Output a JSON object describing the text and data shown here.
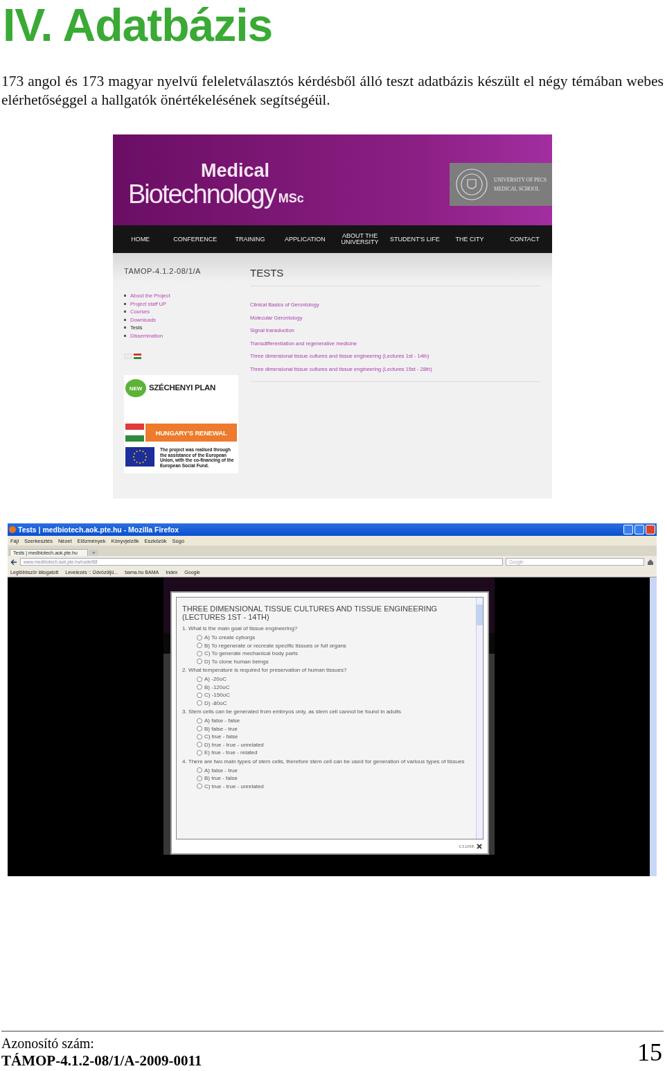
{
  "heading": "IV. Adatbázis",
  "intro": "173 angol és 173 magyar nyelvű feleletválasztós kérdésből álló teszt adatbázis készült el négy témában webes elérhetőséggel a hallgatók önértékelésének segítségéül.",
  "site_screenshot": {
    "logo": {
      "line1": "Medical",
      "line2": "Biotechnology",
      "suffix": "MSc"
    },
    "university_badge": [
      "UNIVERSITY OF PECS",
      "MEDICAL SCHOOL"
    ],
    "nav": [
      "HOME",
      "CONFERENCE",
      "TRAINING",
      "APPLICATION",
      "ABOUT THE UNIVERSITY",
      "STUDENT'S LIFE",
      "THE CITY",
      "CONTACT"
    ],
    "sidebar": {
      "project_code": "TAMOP-4.1.2-08/1/A",
      "links": [
        {
          "label": "About the Project",
          "selected": false
        },
        {
          "label": "Project staff UP",
          "selected": false
        },
        {
          "label": "Courses",
          "selected": false
        },
        {
          "label": "Downloads",
          "selected": false
        },
        {
          "label": "Tests",
          "selected": true
        },
        {
          "label": "Dissemination",
          "selected": false
        }
      ]
    },
    "logos": {
      "new_badge": "NEW",
      "plan": "SZÉCHENYI PLAN",
      "renewal": "HUNGARY'S RENEWAL",
      "eu_note": "The project was realised through the assistance of the European Union, with the co-financing of the European Social Fund."
    },
    "main": {
      "title": "TESTS",
      "links": [
        "Clinical Basics of Gerontology",
        "Molecular Gerontology",
        "Signal transduction",
        "Transdifferentiation and regenerative medicine",
        "Three dimensional tissue cultures and tissue engineering (Lectures 1st - 14th)",
        "Three dimensional tissue cultures and tissue engineering (Lectures 15st - 28th)"
      ]
    }
  },
  "browser": {
    "title": "Tests | medbiotech.aok.pte.hu - Mozilla Firefox",
    "menu": [
      "Fájl",
      "Szerkesztés",
      "Nézet",
      "Előzmények",
      "Könyvjelzők",
      "Eszközök",
      "Súgó"
    ],
    "tab": "Tests | medbiotech.aok.pte.hu",
    "new_tab": "+",
    "url": "www.medbiotech.aok.pte.hu/node/68",
    "search_placeholder": "Google",
    "bookmarks": [
      "Legtöbbször látogatott",
      "Levelezés :: Üdvözöljü...",
      "bama.hu BAMA",
      "Index",
      "Google"
    ],
    "modal": {
      "title": "THREE DIMENSIONAL TISSUE CULTURES AND TISSUE ENGINEERING (LECTURES 1ST - 14TH)",
      "close": "CLOSE",
      "questions": [
        {
          "text": "1. What is the main goal of tissue engineering?",
          "options": [
            {
              "label": "A) To create cyborgs",
              "selected": false
            },
            {
              "label": "B) To regenerate or recreate specific tissues or full organs",
              "selected": false
            },
            {
              "label": "C) To generate mechanical body parts",
              "selected": false
            },
            {
              "label": "D) To clone human beings",
              "selected": false
            }
          ]
        },
        {
          "text": "2. What temperature is required for preservation of human tissues?",
          "options": [
            {
              "label": "A) -20oC",
              "selected": false
            },
            {
              "label": "B) -120oC",
              "selected": false
            },
            {
              "label": "C) -150oC",
              "selected": false
            },
            {
              "label": "D) -80oC",
              "selected": false
            }
          ]
        },
        {
          "text": "3. Stem cells can be generated from embryos only, as stem cell cannot be found in adults",
          "options": [
            {
              "label": "A) false - false",
              "selected": false
            },
            {
              "label": "B) false - true",
              "selected": false
            },
            {
              "label": "C) true - false",
              "selected": false
            },
            {
              "label": "D) true - true - unrelated",
              "selected": false
            },
            {
              "label": "E) true - true - related",
              "selected": false
            }
          ]
        },
        {
          "text": "4. There are two main types of stem cells, therefore stem cell can be used for generation of various types of tissues",
          "options": [
            {
              "label": "A) false - true",
              "selected": false
            },
            {
              "label": "B) true - false",
              "selected": false
            },
            {
              "label": "C) true - true - unrelated",
              "selected": false
            }
          ]
        }
      ]
    }
  },
  "footer": {
    "id_label": "Azonosító szám:",
    "id_value": "TÁMOP-4.1.2-08/1/A-2009-0011",
    "page": "15"
  }
}
